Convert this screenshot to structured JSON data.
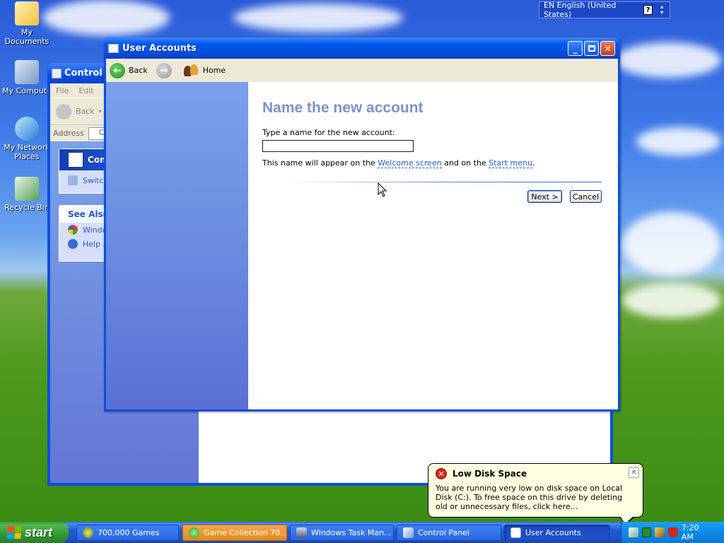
{
  "desktop": {
    "icons": [
      {
        "label": "My Documents"
      },
      {
        "label": "My Compute"
      },
      {
        "label": "My Network Places"
      },
      {
        "label": "Recycle Bin"
      }
    ]
  },
  "language_bar": {
    "label": "EN English (United States)",
    "help": "?"
  },
  "control_panel": {
    "title": "Control P",
    "menu": [
      "File",
      "Edit"
    ],
    "back_label": "Back",
    "address_label": "Address",
    "address_value": "C",
    "task_box": {
      "title": "Contr",
      "items": [
        "Switch"
      ]
    },
    "see_also": {
      "title": "See Also",
      "items": [
        "Windo",
        "Help a"
      ]
    }
  },
  "user_accounts": {
    "title": "User Accounts",
    "nav": {
      "back": "Back",
      "home": "Home"
    },
    "heading": "Name the new account",
    "prompt": "Type a name for the new account:",
    "input_value": "",
    "note_prefix": "This name will appear on the ",
    "note_link1": "Welcome screen",
    "note_middle": " and on the ",
    "note_link2": "Start menu",
    "note_suffix": ".",
    "next_button": "Next >",
    "cancel_button": "Cancel"
  },
  "balloon": {
    "title": "Low Disk Space",
    "text": "You are running very low on disk space on Local Disk (C:). To free space on this drive by deleting old or unnecessary files, click here..."
  },
  "taskbar": {
    "start": "start",
    "tasks": [
      {
        "label": "700,000 Games"
      },
      {
        "label": "Game Collection 70..."
      },
      {
        "label": "Windows Task Man..."
      },
      {
        "label": "Control Panel"
      },
      {
        "label": "User Accounts"
      }
    ],
    "clock": "7:20 AM"
  },
  "colors": {
    "title_blue": "#0050e0",
    "heading": "#7c93c8",
    "link": "#215dc6",
    "balloon_bg": "#ffffe1",
    "start_green": "#3c9a3c"
  }
}
